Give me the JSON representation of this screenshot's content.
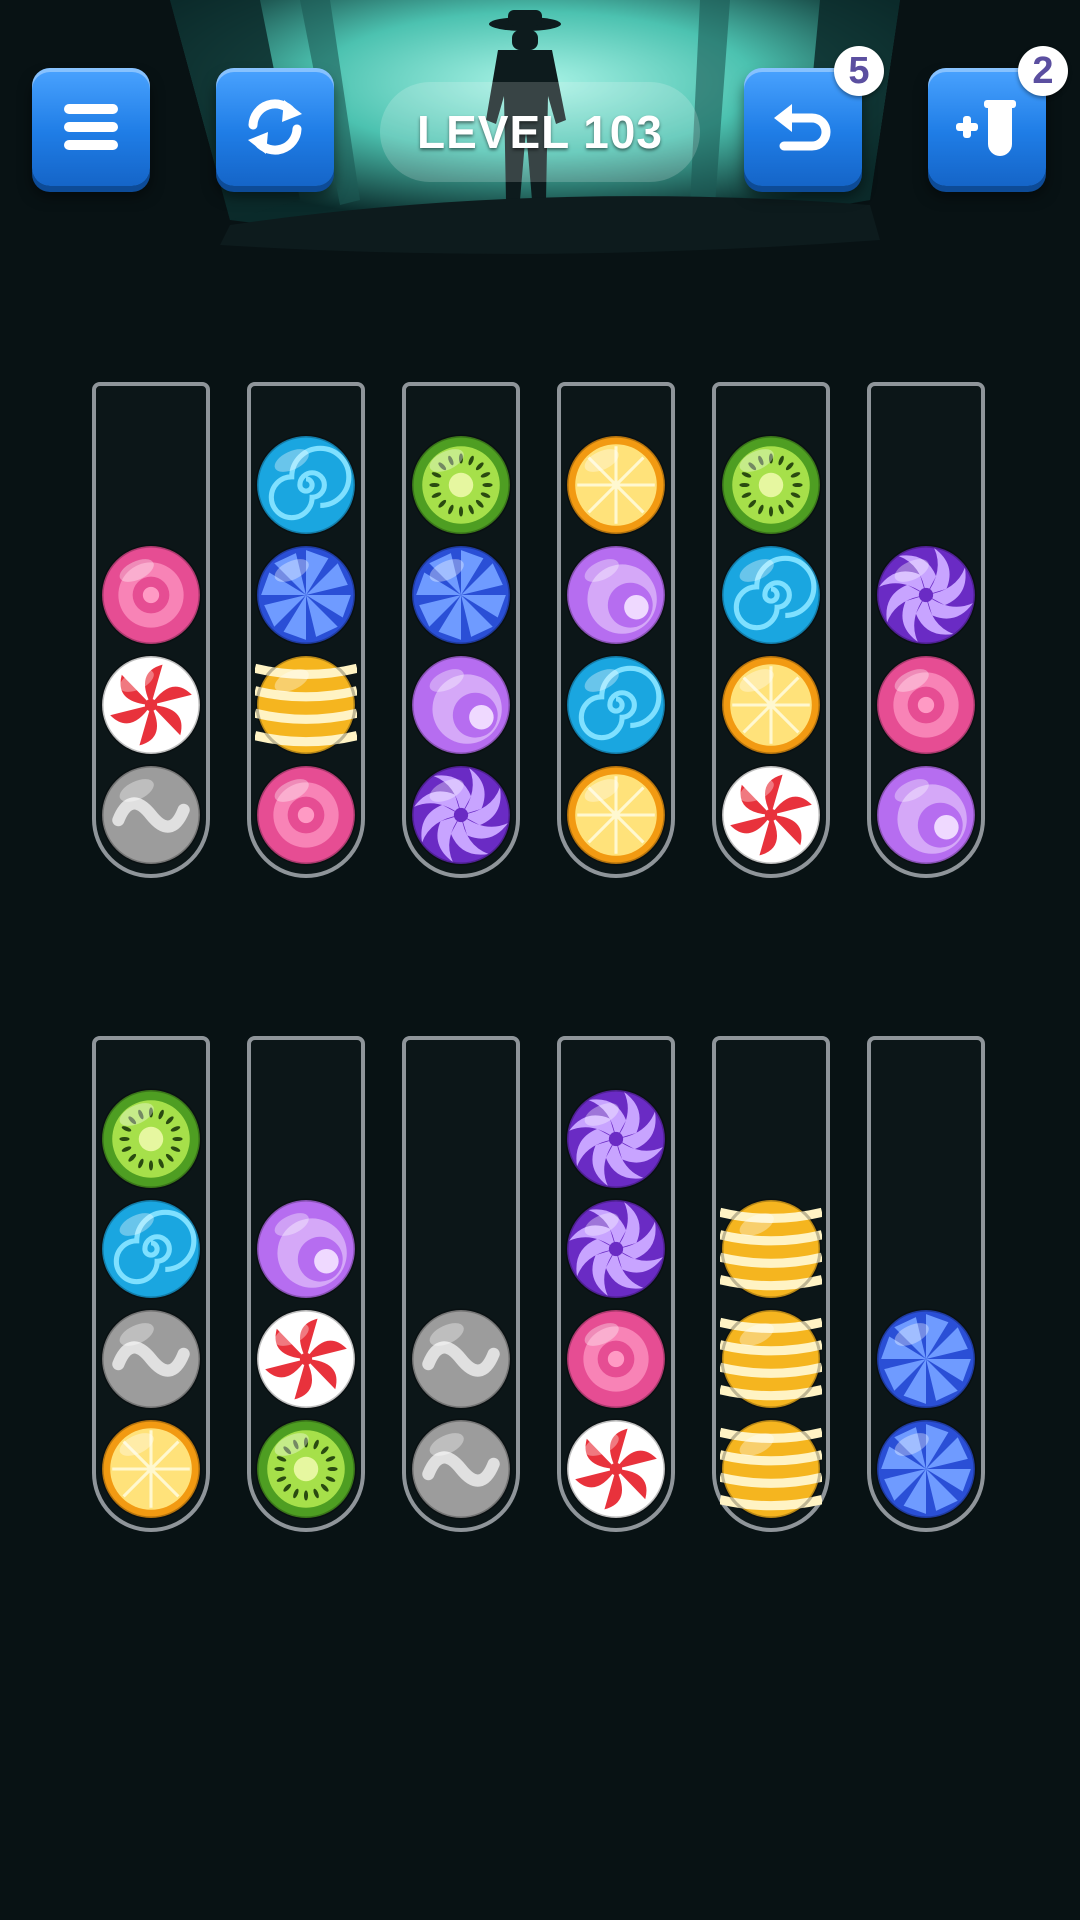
{
  "header": {
    "menu_icon": "hamburger-icon",
    "restart_icon": "refresh-icon",
    "level_label": "LEVEL 103",
    "undo": {
      "icon": "undo-arrow-icon",
      "count": "5"
    },
    "add_tube": {
      "icon": "add-tube-icon",
      "count": "2"
    }
  },
  "colors": {
    "button_blue": "#1f7de6",
    "background": "#081214",
    "scene_glow": "#7fe8d8"
  },
  "balls": {
    "pink": {
      "name": "pink-target-candy",
      "base": "#e64d93",
      "accent": "#ff9ac4"
    },
    "peppermint": {
      "name": "red-peppermint-candy",
      "base": "#ffffff",
      "accent": "#e8323c"
    },
    "silver": {
      "name": "silver-swirl-candy",
      "base": "#9c9c9c",
      "accent": "#e0e0e0"
    },
    "cyan": {
      "name": "cyan-spiral-candy",
      "base": "#1aa6e0",
      "accent": "#7fe0ff"
    },
    "blue": {
      "name": "blue-pinwheel-candy",
      "base": "#2a4fd6",
      "accent": "#6f9bff"
    },
    "yellow": {
      "name": "yellow-striped-candy",
      "base": "#f5b51f",
      "accent": "#fff3c4"
    },
    "green": {
      "name": "green-kiwi-candy",
      "base": "#4e9e22",
      "accent": "#a6e04a"
    },
    "purple": {
      "name": "purple-swirl-candy",
      "base": "#6a2bc4",
      "accent": "#c8a4ff"
    },
    "lavender": {
      "name": "lavender-crescent-candy",
      "base": "#b66df0",
      "accent": "#efd9ff"
    },
    "orange": {
      "name": "orange-citrus-candy",
      "base": "#f29a12",
      "accent": "#ffe27a"
    }
  },
  "tube_capacity": 4,
  "tubes": [
    [
      "silver",
      "peppermint",
      "pink"
    ],
    [
      "pink",
      "yellow",
      "blue",
      "cyan"
    ],
    [
      "purple",
      "lavender",
      "blue",
      "green"
    ],
    [
      "orange",
      "cyan",
      "lavender",
      "orange"
    ],
    [
      "peppermint",
      "orange",
      "cyan",
      "green"
    ],
    [
      "lavender",
      "pink",
      "purple"
    ],
    [
      "orange",
      "silver",
      "cyan",
      "green"
    ],
    [
      "green",
      "peppermint",
      "lavender"
    ],
    [
      "silver",
      "silver"
    ],
    [
      "peppermint",
      "pink",
      "purple",
      "purple"
    ],
    [
      "yellow",
      "yellow",
      "yellow"
    ],
    [
      "blue",
      "blue"
    ]
  ]
}
